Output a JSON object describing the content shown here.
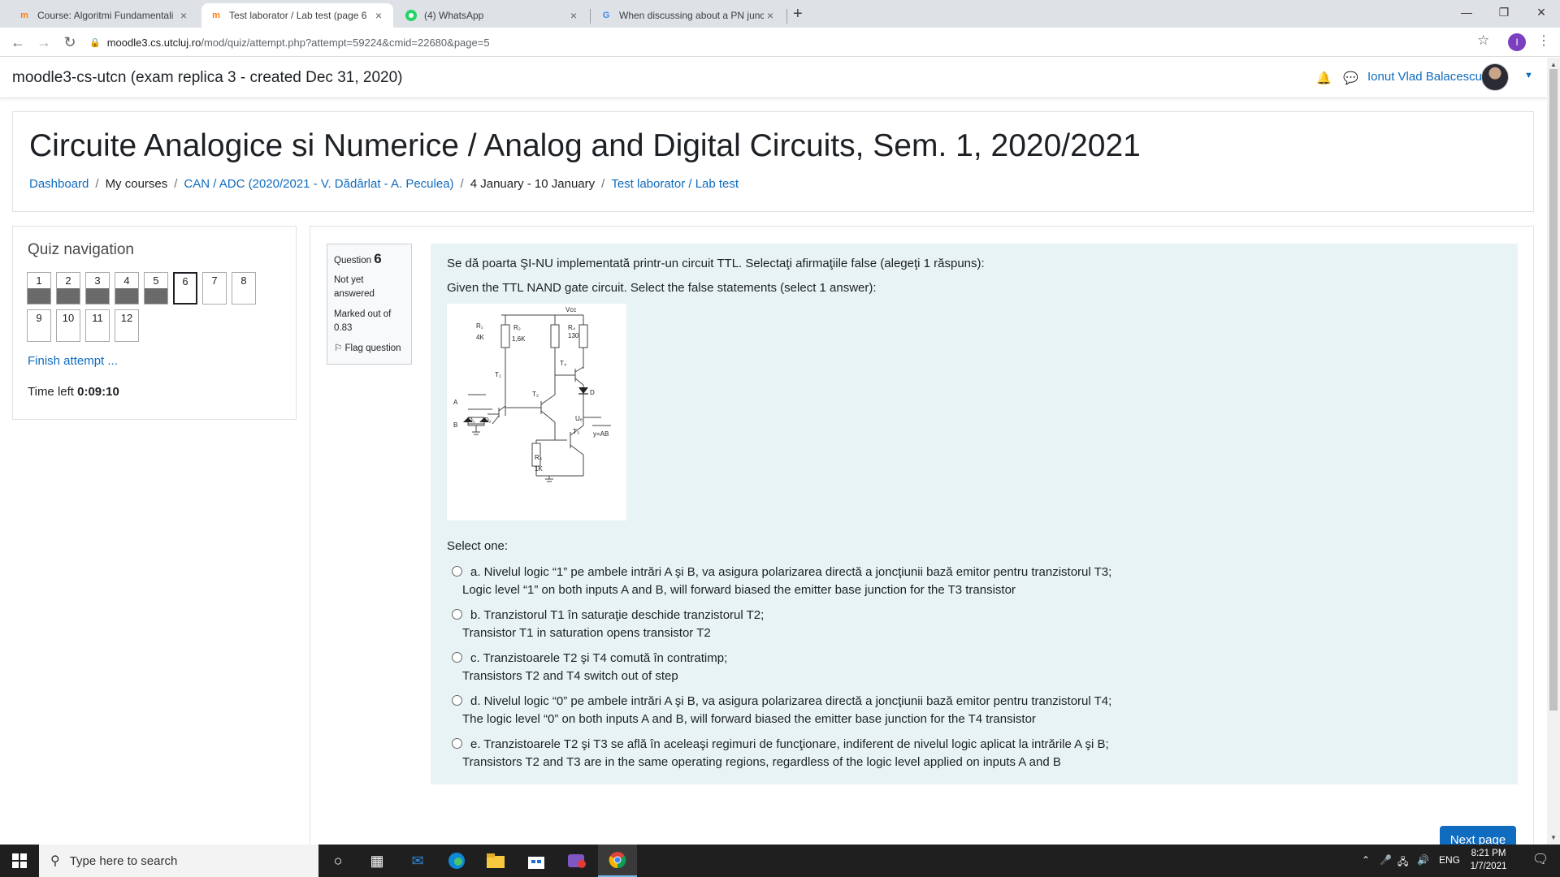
{
  "browser": {
    "tabs": [
      {
        "title": "Course: Algoritmi Fundamentali",
        "favicon": "moodle-icon",
        "active": false
      },
      {
        "title": "Test laborator / Lab test (page 6",
        "favicon": "moodle-icon",
        "active": true
      },
      {
        "title": "(4) WhatsApp",
        "favicon": "whatsapp-icon",
        "active": false
      },
      {
        "title": "When discussing about a PN junc",
        "favicon": "google-icon",
        "active": false
      }
    ],
    "url_host": "moodle3.cs.utcluj.ro",
    "url_path": "/mod/quiz/attempt.php?attempt=59224&cmid=22680&page=5",
    "profile_initial": "I"
  },
  "header": {
    "site_name": "moodle3-cs-utcn (exam replica 3 - created Dec 31, 2020)",
    "user_name": "Ionut Vlad Balacescu"
  },
  "page": {
    "title": "Circuite Analogice si Numerice / Analog and Digital Circuits, Sem. 1, 2020/2021",
    "breadcrumb": [
      {
        "label": "Dashboard",
        "link": true
      },
      {
        "label": "My courses",
        "link": false
      },
      {
        "label": "CAN / ADC (2020/2021 - V. Dădârlat - A. Peculea)",
        "link": true
      },
      {
        "label": "4 January - 10 January",
        "link": false
      },
      {
        "label": "Test laborator / Lab test",
        "link": true
      }
    ]
  },
  "quiz_nav": {
    "heading": "Quiz navigation",
    "questions": [
      {
        "num": "1",
        "state": "answered"
      },
      {
        "num": "2",
        "state": "answered"
      },
      {
        "num": "3",
        "state": "answered"
      },
      {
        "num": "4",
        "state": "answered"
      },
      {
        "num": "5",
        "state": "answered"
      },
      {
        "num": "6",
        "state": "current"
      },
      {
        "num": "7",
        "state": "unanswered"
      },
      {
        "num": "8",
        "state": "unanswered"
      },
      {
        "num": "9",
        "state": "unanswered"
      },
      {
        "num": "10",
        "state": "unanswered"
      },
      {
        "num": "11",
        "state": "unanswered"
      },
      {
        "num": "12",
        "state": "unanswered"
      }
    ],
    "finish_label": "Finish attempt ...",
    "time_left_label": "Time left",
    "time_left_value": "0:09:10"
  },
  "question": {
    "label": "Question",
    "number": "6",
    "status": "Not yet answered",
    "marked": "Marked out of 0.83",
    "flag_label": "Flag question",
    "text_ro": "Se dă poarta ŞI-NU implementată printr-un circuit TTL. Selectaţi afirmaţiile false (alegeţi 1 răspuns):",
    "text_en": "Given the TTL NAND gate circuit. Select the false statements (select 1 answer):",
    "select_one": "Select one:",
    "options": [
      {
        "ro": "a. Nivelul logic “1” pe ambele intrări A şi B, va asigura polarizarea directă a joncţiunii bază emitor pentru tranzistorul T3;",
        "en": "Logic level “1” on both inputs A and B, will forward biased the emitter base junction for the T3 transistor"
      },
      {
        "ro": "b. Tranzistorul T1 în saturaţie deschide tranzistorul T2;",
        "en": "Transistor T1 in saturation opens transistor T2"
      },
      {
        "ro": "c. Tranzistoarele T2 şi T4 comută în contratimp;",
        "en": "Transistors T2 and T4 switch out of step"
      },
      {
        "ro": "d. Nivelul logic “0” pe ambele intrări A şi B, va asigura polarizarea directă a joncţiunii bază emitor pentru tranzistorul T4;",
        "en": "The logic level “0” on both inputs A and B, will forward biased the emitter base junction for the T4 transistor"
      },
      {
        "ro": "e. Tranzistoarele T2 şi T3 se află în aceleaşi regimuri de funcţionare, indiferent de nivelul logic aplicat la intrările A şi B;",
        "en": "Transistors T2 and T3 are in the same operating regions, regardless of the logic level applied on inputs A and B"
      }
    ],
    "next_label": "Next page"
  },
  "circuit": {
    "vcc": "Vcc",
    "r1": "R₁",
    "r1_val": "4K",
    "r2": "R₂",
    "r2_val": "1,6K",
    "r4": "R₄",
    "r4_val": "130",
    "r3": "R₃",
    "r3_val": "1K",
    "t1": "T₁",
    "t2": "T₂",
    "t3": "T₃",
    "t4": "T₄",
    "d": "D",
    "a": "A",
    "b": "B",
    "d1": "D₁",
    "d2": "D₂",
    "ue": "Uₑ",
    "y": "y=AB"
  },
  "taskbar": {
    "search_placeholder": "Type here to search",
    "lang": "ENG",
    "time": "8:21 PM",
    "date": "1/7/2021"
  },
  "colors": {
    "link": "#0f6cbf",
    "formulation_bg": "#e7f3f5",
    "answered_fill": "#6a6a6a"
  }
}
